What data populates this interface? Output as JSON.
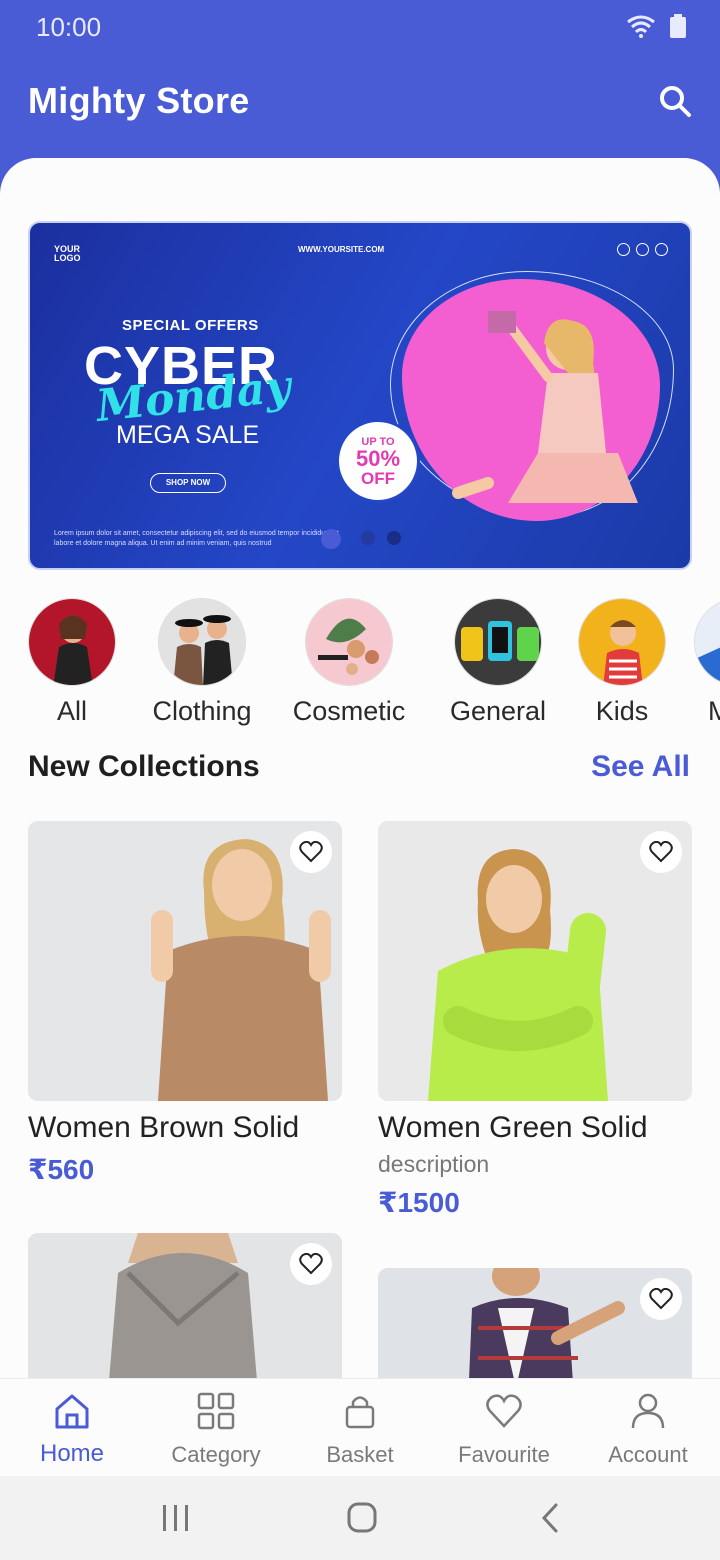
{
  "status_bar": {
    "time": "10:00"
  },
  "app_bar": {
    "title": "Mighty Store",
    "search_icon": "search-icon"
  },
  "banner": {
    "logo_text_1": "YOUR",
    "logo_text_2": "LOGO",
    "site": "WWW.YOURSITE.COM",
    "special_offers": "SPECIAL OFFERS",
    "headline_1": "CYBER",
    "headline_2": "Monday",
    "headline_3": "MEGA SALE",
    "shop_now": "SHOP NOW",
    "badge_top": "UP TO",
    "badge_pct": "50%",
    "badge_off": "OFF",
    "fine_print": "Lorem ipsum dolor sit amet, consectetur adipiscing elit, sed do eiusmod tempor incididunt ut labore et dolore magna aliqua. Ut enim ad minim veniam, quis nostrud"
  },
  "categories": [
    {
      "label": "All"
    },
    {
      "label": "Clothing"
    },
    {
      "label": "Cosmetic"
    },
    {
      "label": "General"
    },
    {
      "label": "Kids"
    },
    {
      "label": "M"
    }
  ],
  "section": {
    "title": "New Collections",
    "see_all": "See All"
  },
  "products": [
    {
      "name": "Women Brown Solid",
      "price": "₹560"
    },
    {
      "name": "Women Green Solid",
      "description": "description",
      "price": "₹1500"
    },
    {
      "name": "",
      "price": ""
    },
    {
      "name": "",
      "price": ""
    }
  ],
  "bottom_nav": [
    {
      "label": "Home",
      "icon": "home-icon",
      "active": true
    },
    {
      "label": "Category",
      "icon": "grid-icon"
    },
    {
      "label": "Basket",
      "icon": "bag-icon"
    },
    {
      "label": "Favourite",
      "icon": "heart-icon"
    },
    {
      "label": "Account",
      "icon": "person-icon"
    }
  ],
  "colors": {
    "primary": "#4a5bd6",
    "background": "#fcfcfc",
    "text": "#222222"
  }
}
